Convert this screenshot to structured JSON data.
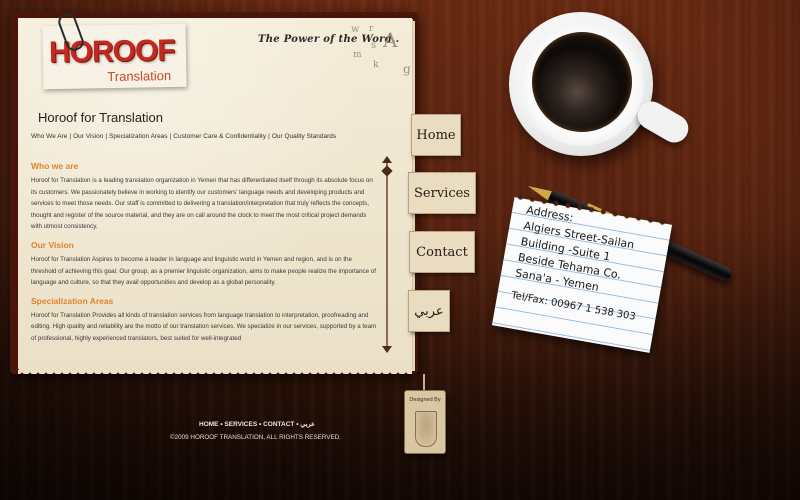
{
  "logo": {
    "main": "HOROOF",
    "sub": "Translation"
  },
  "tagline": "The Power of the Word..",
  "page": {
    "title": "Horoof for Translation",
    "links": [
      "Who We Are",
      "Our Vision",
      "Specialization Areas",
      "Customer Care & Confidentiality",
      "Our Quality Standards"
    ],
    "separator": "|"
  },
  "sections": [
    {
      "heading": "Who we are",
      "body": "Horoof for Translation is a leading translation organization in Yemen that has differentiated itself through its absolute focus on its customers. We passionately believe in working to identify our customers' language needs and developing products and services to meet those needs. Our staff is committed to delivering a translation/interpretation that truly reflects the concepts, thought and register of the source material, and they are on call around the clock to meet the most critical project demands with utmost consistency."
    },
    {
      "heading": "Our Vision",
      "body": "Horoof for Translation Aspires to become a leader in language and linguistic world in Yemen and region, and is on the threshold of achieving this goal. Our group, as a premier linguistic organization, aims to make people realize the importance of language and culture, so that they avail opportunities and develop as a global personality."
    },
    {
      "heading": "Specialization Areas",
      "body": "Horoof for Translation Provides all kinds of translation services from language translation to interpretation, proofreading and editing. High quality and reliability are the motto of our translation services. We specialize in our services, supported by a team of professional, highly experienced translators, best suited for well-integrated"
    }
  ],
  "tabs": {
    "home": "Home",
    "services": "Services",
    "contact": "Contact",
    "arabic": "عربي"
  },
  "note": {
    "lines": [
      "Address:",
      "Algiers Street-Sailan",
      "Building -Suite 1",
      "Beside Tehama Co.",
      "Sana'a - Yemen",
      "Tel/Fax: 00967 1 538 303"
    ]
  },
  "footer": {
    "nav": [
      "HOME",
      "SERVICES",
      "CONTACT",
      "عربي"
    ],
    "nav_sep": "•",
    "copyright": "©2009 HOROOF TRANSLATION, ALL RIGHTS RESERVED."
  },
  "designed_by": "Designed By",
  "decor_letters": [
    "w",
    "A",
    "r",
    "s",
    "m",
    "k",
    "g"
  ],
  "colors": {
    "accent": "#e0832a",
    "logo_red": "#c22a1f",
    "wood": "#5a2410",
    "paper": "#f1e8d3"
  }
}
